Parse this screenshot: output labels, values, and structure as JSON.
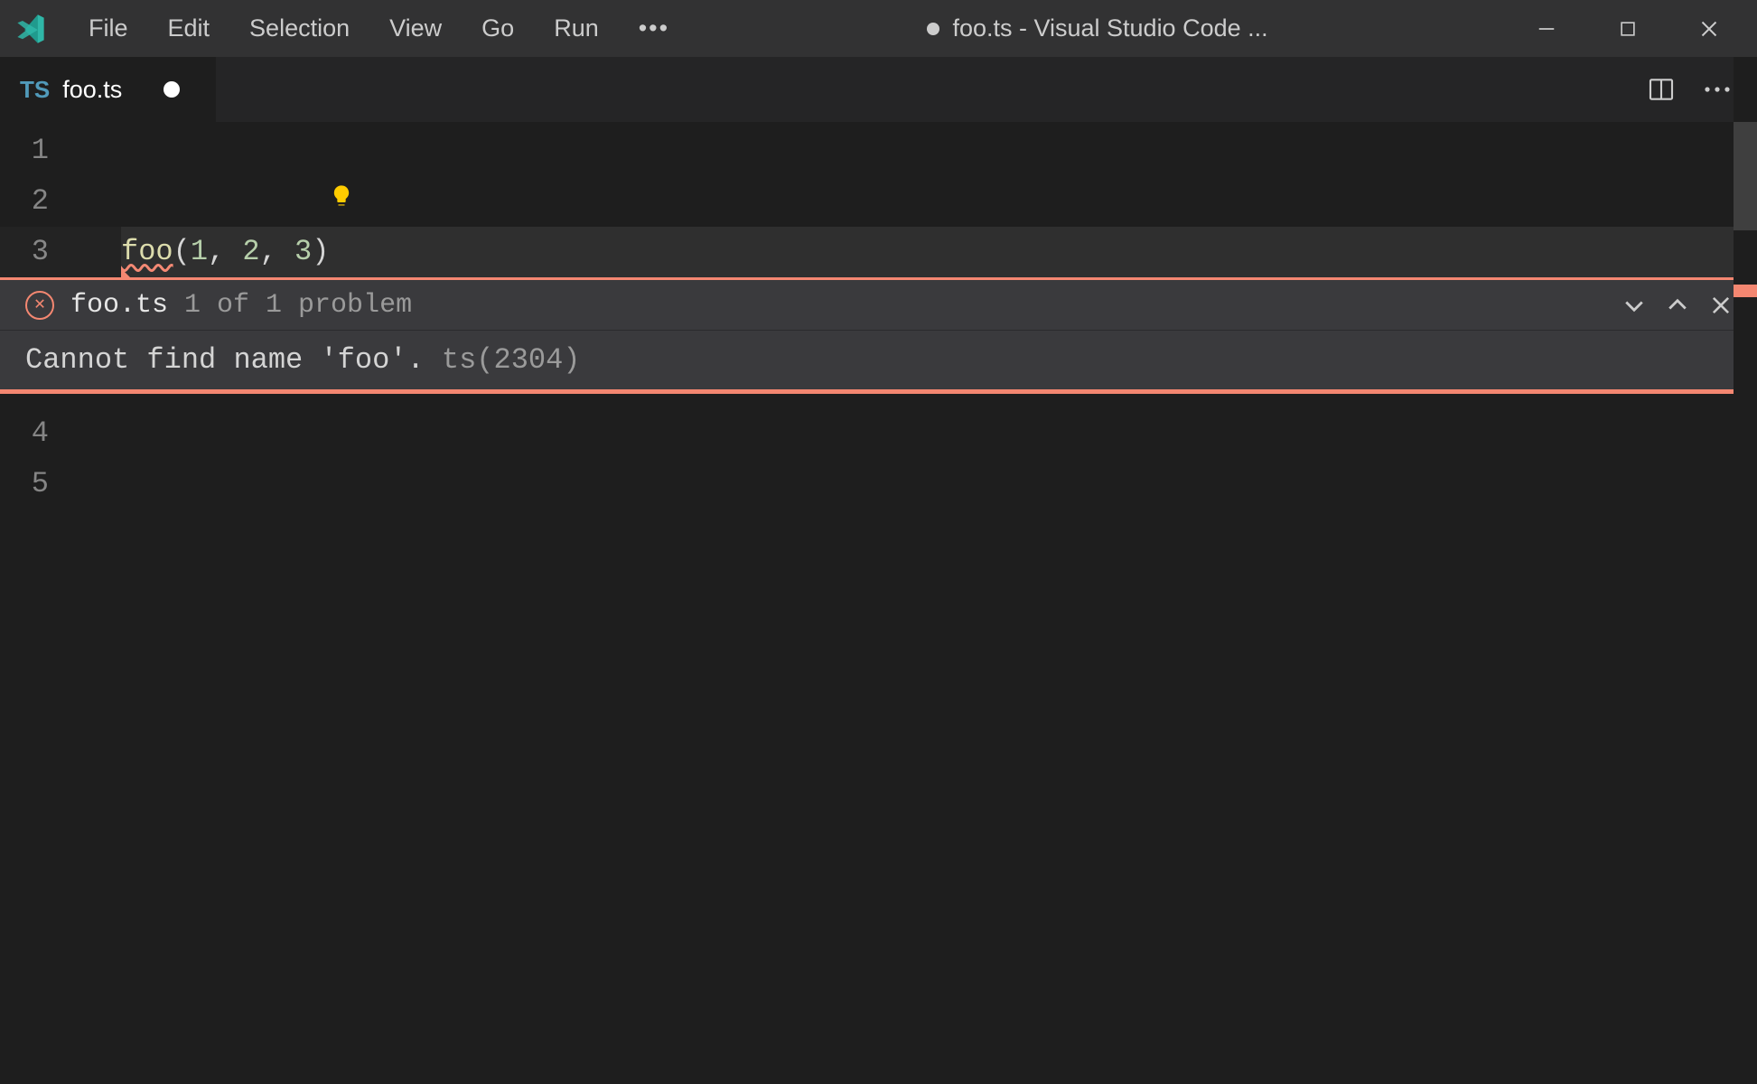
{
  "window": {
    "title": "foo.ts - Visual Studio Code ...",
    "dirty": true
  },
  "menu": [
    "File",
    "Edit",
    "Selection",
    "View",
    "Go",
    "Run"
  ],
  "tabs": [
    {
      "icon": "TS",
      "label": "foo.ts",
      "dirty": true
    }
  ],
  "editor": {
    "lines": [
      {
        "n": 1,
        "text": ""
      },
      {
        "n": 2,
        "text": "",
        "lightbulb": true
      },
      {
        "n": 3,
        "text": "foo(1, 2, 3)",
        "error_span": "foo",
        "current": true
      },
      {
        "n": 4,
        "text": ""
      },
      {
        "n": 5,
        "text": ""
      }
    ]
  },
  "code_tokens": {
    "fn": "foo",
    "open": "(",
    "n1": "1",
    "c1": ", ",
    "n2": "2",
    "c2": ", ",
    "n3": "3",
    "close": ")"
  },
  "peek": {
    "filename": "foo.ts",
    "count_text": "1 of 1 problem",
    "message": "Cannot find name 'foo'. ",
    "code_label": "ts(2304)"
  },
  "colors": {
    "error": "#f48771",
    "lightbulb": "#ffcc00",
    "ts_icon": "#519aba"
  }
}
